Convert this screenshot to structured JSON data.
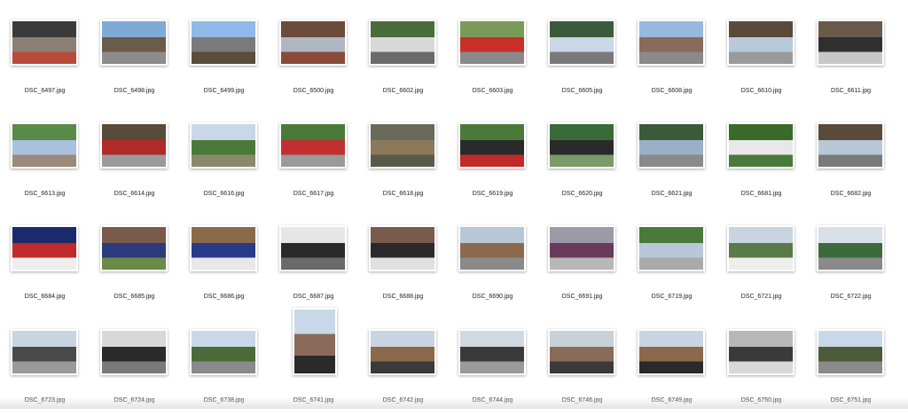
{
  "files": [
    {
      "name": "DSC_6497.jpg",
      "colors": [
        "#3a3a3a",
        "#8a7f72",
        "#b84a3a"
      ]
    },
    {
      "name": "DSC_6498.jpg",
      "colors": [
        "#7fa9d6",
        "#6b5b4a",
        "#8c8c8c"
      ]
    },
    {
      "name": "DSC_6499.jpg",
      "colors": [
        "#8fb9e8",
        "#7a7a7a",
        "#5a4c3c"
      ]
    },
    {
      "name": "DSC_6500.jpg",
      "colors": [
        "#6b4b3b",
        "#b0b7c1",
        "#8a4a3a"
      ]
    },
    {
      "name": "DSC_6602.jpg",
      "colors": [
        "#4a6b3a",
        "#d8d8d8",
        "#6a6a6a"
      ]
    },
    {
      "name": "DSC_6603.jpg",
      "colors": [
        "#7a9a5a",
        "#c8302a",
        "#8a8a8a"
      ]
    },
    {
      "name": "DSC_6605.jpg",
      "colors": [
        "#3a5a3a",
        "#c9d7e6",
        "#7a7a7a"
      ]
    },
    {
      "name": "DSC_6608.jpg",
      "colors": [
        "#98b8e0",
        "#8a6a5a",
        "#8a8a8a"
      ]
    },
    {
      "name": "DSC_6610.jpg",
      "colors": [
        "#5a4a3a",
        "#b9c9dc",
        "#9a9a9a"
      ]
    },
    {
      "name": "DSC_6611.jpg",
      "colors": [
        "#6a5a4a",
        "#2f2f2f",
        "#c8c8c8"
      ]
    },
    {
      "name": "DSC_6613.jpg",
      "colors": [
        "#5a8a4a",
        "#a9c1dc",
        "#9a8a7a"
      ]
    },
    {
      "name": "DSC_6614.jpg",
      "colors": [
        "#5a4a3a",
        "#b02a2a",
        "#9a9a9a"
      ]
    },
    {
      "name": "DSC_6616.jpg",
      "colors": [
        "#c8d8e8",
        "#4a7a3a",
        "#8a8a6a"
      ]
    },
    {
      "name": "DSC_6617.jpg",
      "colors": [
        "#4a7a3a",
        "#c03030",
        "#9a9a9a"
      ]
    },
    {
      "name": "DSC_6618.jpg",
      "colors": [
        "#6a6a5a",
        "#8a7a5a",
        "#5a5a4a"
      ]
    },
    {
      "name": "DSC_6619.jpg",
      "colors": [
        "#4a7a3a",
        "#2a2a2a",
        "#c02a2a"
      ]
    },
    {
      "name": "DSC_6620.jpg",
      "colors": [
        "#3a6a3a",
        "#2a2a2a",
        "#7a9a6a"
      ]
    },
    {
      "name": "DSC_6621.jpg",
      "colors": [
        "#3a5a3a",
        "#9ab0c8",
        "#8a8a8a"
      ]
    },
    {
      "name": "DSC_6681.jpg",
      "colors": [
        "#3a6a2a",
        "#e8e8e8",
        "#4a7a3a"
      ]
    },
    {
      "name": "DSC_6682.jpg",
      "colors": [
        "#5a4a3a",
        "#b8c8d8",
        "#7a7a7a"
      ]
    },
    {
      "name": "DSC_6684.jpg",
      "colors": [
        "#1a2a6a",
        "#c02a2a",
        "#eeeeee"
      ]
    },
    {
      "name": "DSC_6685.jpg",
      "colors": [
        "#7a5a4a",
        "#2a3a7a",
        "#6a8a4a"
      ]
    },
    {
      "name": "DSC_6686.jpg",
      "colors": [
        "#8a6a4a",
        "#2a3a8a",
        "#e8e8e8"
      ]
    },
    {
      "name": "DSC_6687.jpg",
      "colors": [
        "#e6e6e6",
        "#2a2a2a",
        "#6a6a6a"
      ]
    },
    {
      "name": "DSC_6688.jpg",
      "colors": [
        "#7a5a4a",
        "#2a2a2a",
        "#e0e0e0"
      ]
    },
    {
      "name": "DSC_6690.jpg",
      "colors": [
        "#b8c8d8",
        "#8a6a4a",
        "#8a8a8a"
      ]
    },
    {
      "name": "DSC_6691.jpg",
      "colors": [
        "#9a9aa8",
        "#6a3a5a",
        "#b8b8b8"
      ]
    },
    {
      "name": "DSC_6719.jpg",
      "colors": [
        "#4a7a3a",
        "#b8c8d8",
        "#aaaaaa"
      ]
    },
    {
      "name": "DSC_6721.jpg",
      "colors": [
        "#c8d4e0",
        "#5a7a4a",
        "#eeeeee"
      ]
    },
    {
      "name": "DSC_6722.jpg",
      "colors": [
        "#d8dfe6",
        "#3a6a3a",
        "#8a8a8a"
      ]
    },
    {
      "name": "DSC_6723.jpg",
      "colors": [
        "#c8d4e0",
        "#4a4a4a",
        "#9a9a9a"
      ]
    },
    {
      "name": "DSC_6724.jpg",
      "colors": [
        "#d8d8d8",
        "#2a2a2a",
        "#7a7a7a"
      ]
    },
    {
      "name": "DSC_6738.jpg",
      "colors": [
        "#c8d8e8",
        "#4a6a3a",
        "#8a8a8a"
      ]
    },
    {
      "name": "DSC_6741.jpg",
      "colors": [
        "#c8d8e8",
        "#8a6a5a",
        "#2a2a2a"
      ]
    },
    {
      "name": "DSC_6742.jpg",
      "colors": [
        "#c8d4e0",
        "#8a6a4a",
        "#3a3a3a"
      ]
    },
    {
      "name": "DSC_6744.jpg",
      "colors": [
        "#d0d8e0",
        "#3a3a3a",
        "#9a9a9a"
      ]
    },
    {
      "name": "DSC_6746.jpg",
      "colors": [
        "#c8d0d8",
        "#8a6a5a",
        "#3a3a3a"
      ]
    },
    {
      "name": "DSC_6749.jpg",
      "colors": [
        "#c8d4e0",
        "#8a6a4a",
        "#2a2a2a"
      ]
    },
    {
      "name": "DSC_6750.jpg",
      "colors": [
        "#b8b8b8",
        "#3a3a3a",
        "#d8d8d8"
      ]
    },
    {
      "name": "DSC_6751.jpg",
      "colors": [
        "#c8d8e8",
        "#4a5a3a",
        "#8a8a8a"
      ]
    }
  ]
}
